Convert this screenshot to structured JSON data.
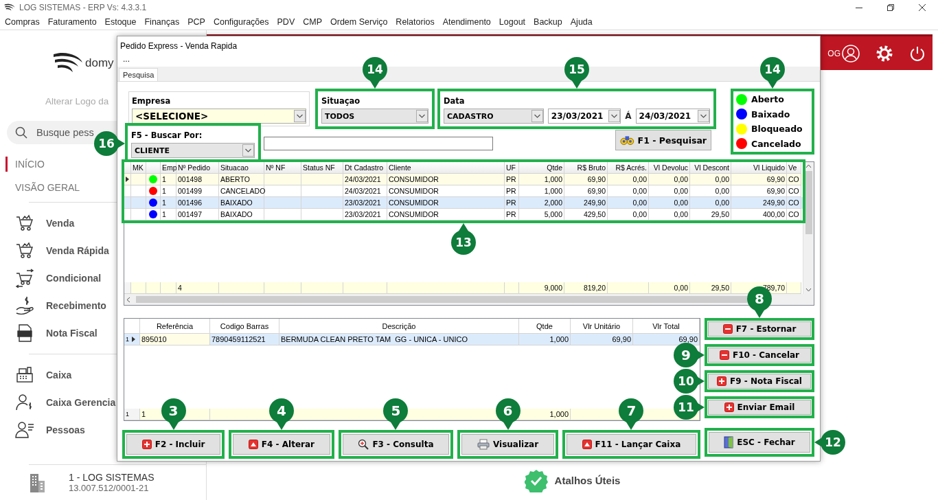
{
  "app": {
    "title": "LOG SISTEMAS - ERP Vs: 4.3.3.1"
  },
  "menu": [
    "Compras",
    "Faturamento",
    "Estoque",
    "Finanças",
    "PCP",
    "Configurações",
    "PDV",
    "CMP",
    "Ordem Serviço",
    "Relatorios",
    "Atendimento",
    "Logout",
    "Backup",
    "Ajuda"
  ],
  "sidebar": {
    "logo": "domy",
    "logo_caption": "Alterar Logo da",
    "search": {
      "placeholder": "Busque pess"
    },
    "sections": [
      {
        "label": "INÍCIO",
        "selected": true
      },
      {
        "label": "VISÃO GERAL",
        "selected": false
      }
    ],
    "groups": [
      [
        "Venda",
        "Venda Rápida",
        "Condicional",
        "Recebimento",
        "Nota Fiscal"
      ],
      [
        "Caixa",
        "Caixa Gerencia",
        "Pessoas"
      ]
    ],
    "company": {
      "name": "1 - LOG SISTEMAS",
      "document": "13.007.512/0001-21"
    }
  },
  "header": {
    "user": "OG"
  },
  "shortcuts": {
    "label": "Atalhos Úteis"
  },
  "dialog": {
    "title": "Pedido Express - Venda Rapida",
    "menu": "...",
    "tabs": [
      {
        "label": "Pesquisa",
        "selected": true
      }
    ],
    "empresa": {
      "label": "Empresa",
      "value": "<SELECIONE>",
      "highlighted": false
    },
    "situacao": {
      "label": "Situaçao",
      "value": "TODOS",
      "highlighted": true,
      "callout": "14"
    },
    "data": {
      "label": "Data",
      "field": "CADASTRO",
      "from": "23/03/2021",
      "separator": "Á",
      "to": "24/03/2021",
      "highlighted": true,
      "callout": "15"
    },
    "legend": {
      "highlighted": true,
      "callout": "14",
      "items": [
        {
          "label": "Aberto",
          "color": "#00ff00"
        },
        {
          "label": "Baixado",
          "color": "#0000ff"
        },
        {
          "label": "Bloqueado",
          "color": "#ffff00"
        },
        {
          "label": "Cancelado",
          "color": "#ff0000"
        }
      ]
    },
    "buscar": {
      "label": "F5 - Buscar Por:",
      "value": "CLIENTE",
      "highlighted": true,
      "callout": "16"
    },
    "search_button": {
      "label": "F1 - Pesquisar",
      "highlighted": false
    },
    "orders": {
      "highlighted": true,
      "callout": "13",
      "columns": [
        "MK",
        "Emp",
        "Nº Pedido",
        "Situacao",
        "Nº NF",
        "Status NF",
        "Dt Cadastro",
        "Cliente",
        "UF",
        "Qtde",
        "R$ Bruto",
        "R$ Acrés.",
        "Vl Devoluc",
        "Vl Descont",
        "Vl Liquido",
        "Ve"
      ],
      "rows": [
        {
          "current": true,
          "selected": false,
          "color": "#00ff00",
          "emp": "1",
          "pedido": "001498",
          "situacao": "ABERTO",
          "dt_cadastro": "24/03/2021",
          "cliente": "CONSUMIDOR",
          "uf": "PR",
          "qtde": "1,000",
          "bruto": "69,90",
          "acres": "0,00",
          "devoluc": "0,00",
          "descont": "0,00",
          "liquido": "69,90",
          "ve": "CO"
        },
        {
          "current": false,
          "selected": false,
          "color": "#ff0000",
          "emp": "1",
          "pedido": "001499",
          "situacao": "CANCELADO",
          "dt_cadastro": "24/03/2021",
          "cliente": "CONSUMIDOR",
          "uf": "PR",
          "qtde": "1,000",
          "bruto": "69,90",
          "acres": "0,00",
          "devoluc": "0,00",
          "descont": "0,00",
          "liquido": "69,90",
          "ve": "CO"
        },
        {
          "current": false,
          "selected": true,
          "color": "#0000ff",
          "emp": "1",
          "pedido": "001496",
          "situacao": "BAIXADO",
          "dt_cadastro": "23/03/2021",
          "cliente": "CONSUMIDOR",
          "uf": "PR",
          "qtde": "2,000",
          "bruto": "249,90",
          "acres": "0,00",
          "devoluc": "0,00",
          "descont": "0,00",
          "liquido": "249,90",
          "ve": "CO"
        },
        {
          "current": false,
          "selected": false,
          "color": "#0000ff",
          "emp": "1",
          "pedido": "001497",
          "situacao": "BAIXADO",
          "dt_cadastro": "23/03/2021",
          "cliente": "CONSUMIDOR",
          "uf": "PR",
          "qtde": "5,000",
          "bruto": "429,50",
          "acres": "0,00",
          "devoluc": "0,00",
          "descont": "29,50",
          "liquido": "400,00",
          "ve": "CO"
        }
      ],
      "totals": {
        "pedido": "4",
        "qtde": "9,000",
        "bruto": "819,20",
        "devoluc": "0,00",
        "descont": "29,50",
        "liquido": "789,70"
      }
    },
    "items": {
      "columns": [
        "Referência",
        "Codigo Barras",
        "Descrição",
        "Qtde",
        "Vlr Unitário",
        "Vlr Total"
      ],
      "rows": [
        {
          "number": "1",
          "current": true,
          "cells": [
            "895010",
            "7890459112521",
            "BERMUDA CLEAN PRETO TAM  GG - UNICA - UNICO",
            "1,000",
            "69,90",
            "69,90"
          ]
        }
      ],
      "totals": {
        "number": "1",
        "referencia": "1",
        "qtde": "1,000"
      }
    },
    "actions": [
      {
        "label": "F2 - Incluir",
        "highlighted": true,
        "callout": "3"
      },
      {
        "label": "F4 - Alterar",
        "highlighted": true,
        "callout": "4"
      },
      {
        "label": "F3 - Consulta",
        "highlighted": true,
        "callout": "5"
      },
      {
        "label": "Visualizar",
        "highlighted": true,
        "callout": "6"
      },
      {
        "label": "F11 - Lançar Caixa",
        "highlighted": true,
        "callout": "7"
      }
    ],
    "side_actions": [
      {
        "label": "F7 - Estornar",
        "highlighted": true,
        "callout": "8"
      },
      {
        "label": "F10 - Cancelar",
        "highlighted": true,
        "callout": "9"
      },
      {
        "label": "F9 - Nota Fiscal",
        "highlighted": true,
        "callout": "10"
      },
      {
        "label": "Enviar Email",
        "highlighted": true,
        "callout": "11"
      }
    ],
    "close": {
      "label": "ESC - Fechar",
      "highlighted": true,
      "callout": "12"
    }
  }
}
